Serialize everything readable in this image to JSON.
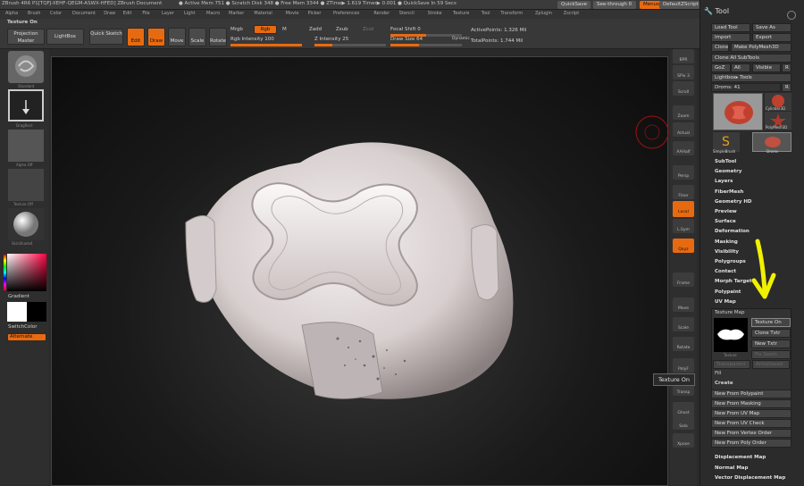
{
  "titlebar": {
    "app_info": "ZBrush 4R6  P1[TQFJ-XEHF-QEGM-ASWX-HFED]    ZBrush Document",
    "stats": "● Active Mem 751 ● Scratch Disk 348 ● Free Mem 3344 ● ZTime▶ 1.619  Timer▶ 0.001 ● QuickSave In 59 Secs",
    "quicksave": "QuickSave",
    "seethrough": "See-through  0",
    "menus": "Menus",
    "defaultzscript": "DefaultZScript"
  },
  "menubar": [
    "Alpha",
    "Brush",
    "Color",
    "Document",
    "Draw",
    "Edit",
    "File",
    "Layer",
    "Light",
    "Macro",
    "Marker",
    "Material",
    "Movie",
    "Picker",
    "Preferences",
    "Render",
    "Stencil",
    "Stroke",
    "Texture",
    "Tool",
    "Transform",
    "Zplugin",
    "Zscript"
  ],
  "shelf": {
    "texture_on": "Texture On",
    "projection_master": "Projection Master",
    "lightbox": "LightBox",
    "quick_sketch": "Quick Sketch",
    "edit": "Edit",
    "draw": "Draw",
    "move": "Move",
    "scale": "Scale",
    "rotate": "Rotate",
    "mrgb": "Mrgb",
    "rgb": "Rgb",
    "m": "M",
    "rgb_intensity": "Rgb Intensity 100",
    "zadd": "Zadd",
    "zsub": "Zsub",
    "zcut": "Zcut",
    "z_intensity": "Z Intensity 25",
    "focal_shift": "Focal Shift 0",
    "draw_size": "Draw Size 64",
    "dynamic": "Dynamic",
    "active_points": "ActivePoints: 1.326 Mil",
    "total_points": "TotalPoints: 1.744 Mil",
    "rgb_intensity_value": 100,
    "z_intensity_value": 25
  },
  "leftshelf": {
    "standard": "Standard",
    "dragrect": "DragRect",
    "alpha_off": "Alpha Off",
    "texture_off": "Texture Off",
    "material": "SkinShade4",
    "gradient": "Gradient",
    "switchcolor": "SwitchColor",
    "alternate": "Alternate"
  },
  "rightshelf": [
    "BPR",
    "SPix 3",
    "Scroll",
    "Zoom",
    "Actual",
    "AAHalf",
    "Persp",
    "Floor",
    "Local",
    "L.Sym",
    "Qxyz",
    "Frame",
    "Move",
    "Scale",
    "Rotate",
    "PolyF",
    "Transp",
    "Ghost",
    "Solo",
    "Xpose"
  ],
  "tooltip": "Texture On",
  "panel": {
    "title": "Tool",
    "load_tool": "Load Tool",
    "save_as": "Save As",
    "import": "Import",
    "export": "Export",
    "clone": "Clone",
    "make_polymesh": "Make PolyMesh3D",
    "clone_all": "Clone All SubTools",
    "goz": "GoZ",
    "all": "All",
    "visible": "Visible",
    "r": "R",
    "lightbox_tools": "Lightbox▸ Tools",
    "draw_item": "Droms: 41",
    "thumbs": [
      "Cylinder3D",
      "PolyMesh3D",
      "SimpleBrush",
      "Droms"
    ],
    "sections": [
      "SubTool",
      "Geometry",
      "Layers",
      "FiberMesh",
      "Geometry HD",
      "Preview",
      "Surface",
      "Deformation",
      "Masking",
      "Visibility",
      "Polygroups",
      "Contact",
      "Morph Target",
      "Polypaint",
      "UV Map"
    ],
    "texture_map": "Texture Map",
    "texture_on": "Texture On",
    "clone_txtr": "Clone Txtr",
    "new_txtr": "New Txtr",
    "fix_seam": "Fix Seam",
    "texture_label": "Texture",
    "transparent": "Transparent",
    "antialiased": "Antialiased",
    "fill": "Fill",
    "create": "Create",
    "create_items": [
      "New From Polypaint",
      "New From Masking",
      "New From UV Map",
      "New From UV Check",
      "New From Vertex Order",
      "New From Poly Order"
    ],
    "bottom_sections": [
      "Displacement Map",
      "Normal Map",
      "Vector Displacement Map"
    ]
  },
  "colors": {
    "accent": "#e86a10",
    "arrow": "#f0f000"
  }
}
